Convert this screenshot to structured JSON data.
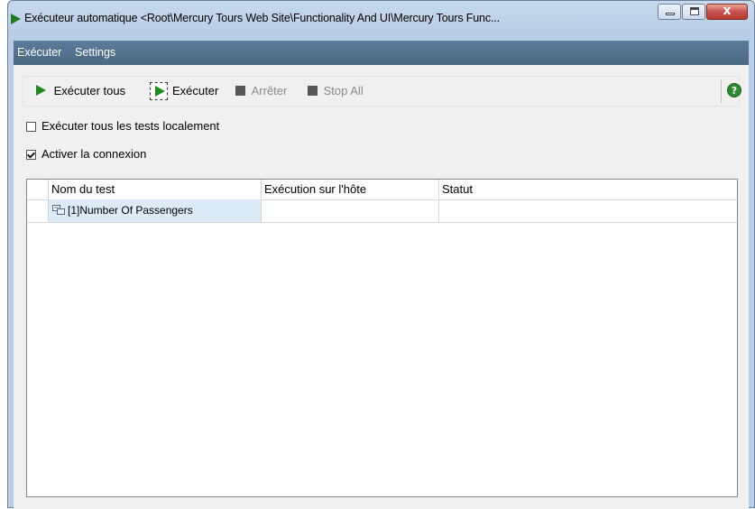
{
  "window": {
    "title": "Exécuteur automatique <Root\\Mercury Tours Web Site\\Functionality And UI\\Mercury Tours Func...",
    "close_glyph": "x"
  },
  "menu": {
    "items": [
      {
        "label": "Exécuter"
      },
      {
        "label": "Settings"
      }
    ]
  },
  "toolbar": {
    "run_all_label": "Exécuter tous",
    "run_label": "Exécuter",
    "stop_label": "Arrêter",
    "stop_all_label": "Stop All",
    "help_glyph": "?"
  },
  "options": {
    "run_locally": {
      "label": "Exécuter tous les tests localement",
      "checked": false
    },
    "enable_connection": {
      "label": "Activer la connexion",
      "checked": true
    }
  },
  "grid": {
    "columns": [
      "Nom du test",
      "Exécution sur l'hôte",
      "Statut"
    ],
    "rows": [
      {
        "name": "[1]Number Of Passengers",
        "host": "",
        "status": ""
      }
    ]
  },
  "colors": {
    "run_green": "#1f8a1f",
    "menubar": "#4a6884",
    "selected_cell": "#dcebf7"
  },
  "icons": [
    "play-icon",
    "stop-icon",
    "help-icon",
    "test-icon",
    "minimize-icon",
    "maximize-icon",
    "close-icon"
  ]
}
